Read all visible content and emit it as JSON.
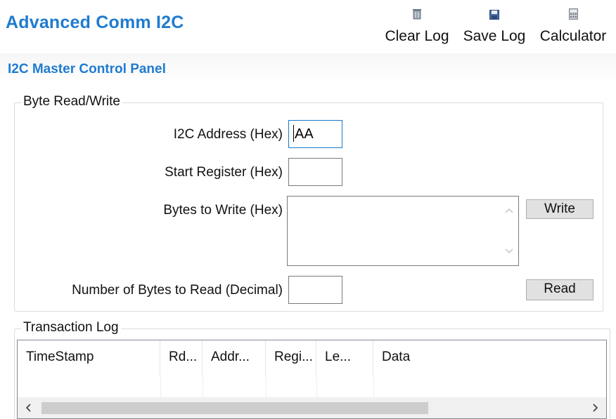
{
  "app": {
    "title": "Advanced Comm I2C"
  },
  "toolbar": {
    "clear_log": {
      "label": "Clear Log",
      "icon": "clear-log-icon"
    },
    "save_log": {
      "label": "Save Log",
      "icon": "save-icon"
    },
    "calculator": {
      "label": "Calculator",
      "icon": "calculator-icon"
    }
  },
  "panel": {
    "title": "I2C Master Control Panel"
  },
  "byte_rw": {
    "legend": "Byte Read/Write",
    "i2c_address": {
      "label": "I2C Address (Hex)",
      "value": "AA"
    },
    "start_register": {
      "label": "Start Register (Hex)",
      "value": ""
    },
    "bytes_to_write": {
      "label": "Bytes to Write (Hex)",
      "value": ""
    },
    "bytes_to_read": {
      "label": "Number of Bytes to Read (Decimal)",
      "value": ""
    },
    "write_button": "Write",
    "read_button": "Read"
  },
  "log": {
    "legend": "Transaction Log",
    "columns": [
      "TimeStamp",
      "Rd...",
      "Addr...",
      "Regi...",
      "Le...",
      "Data"
    ],
    "rows": []
  },
  "colors": {
    "accent": "#1f7bd0",
    "focus_border": "#1979ca",
    "button_face": "#e1e1e1"
  }
}
